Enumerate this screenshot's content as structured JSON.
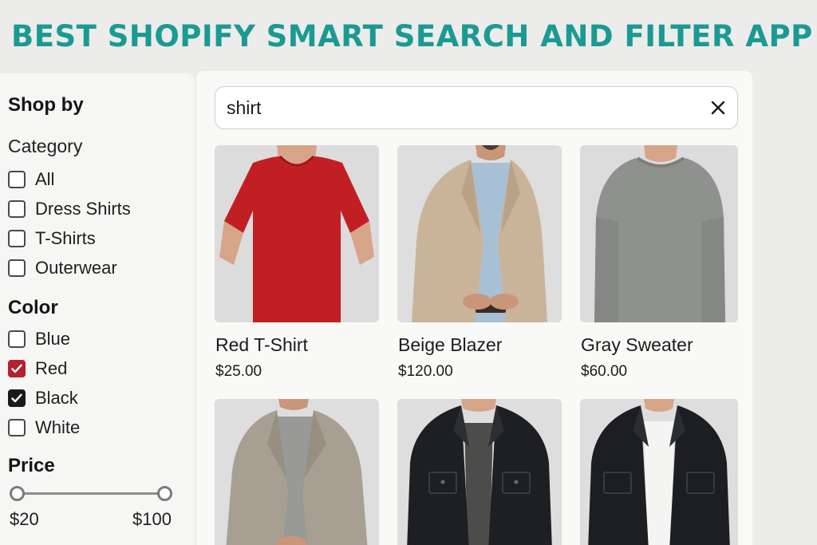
{
  "banner": {
    "title": "BEST SHOPIFY SMART SEARCH AND FILTER APP"
  },
  "sidebar": {
    "heading": "Shop by",
    "category": {
      "label": "Category",
      "options": [
        {
          "label": "All",
          "checked": false
        },
        {
          "label": "Dress Shirts",
          "checked": false
        },
        {
          "label": "T-Shirts",
          "checked": false
        },
        {
          "label": "Outerwear",
          "checked": false
        }
      ]
    },
    "color": {
      "label": "Color",
      "options": [
        {
          "label": "Blue",
          "checked": false
        },
        {
          "label": "Red",
          "checked": true,
          "check_color": "#b3232b"
        },
        {
          "label": "Black",
          "checked": true,
          "check_color": "#1a1a1a"
        },
        {
          "label": "White",
          "checked": false
        }
      ]
    },
    "price": {
      "label": "Price",
      "min_label": "$20",
      "max_label": "$100"
    }
  },
  "search": {
    "value": "shirt",
    "clear_icon": "close-icon"
  },
  "products": [
    {
      "name": "Red T-Shirt",
      "price": "$25.00"
    },
    {
      "name": "Beige Blazer",
      "price": "$120.00"
    },
    {
      "name": "Gray Sweater",
      "price": "$60.00"
    },
    {
      "name": "",
      "price": ""
    },
    {
      "name": "",
      "price": ""
    },
    {
      "name": "",
      "price": ""
    }
  ],
  "colors": {
    "brand": "#1a9a93",
    "red_check": "#b3232b",
    "black_check": "#1a1a1a"
  }
}
